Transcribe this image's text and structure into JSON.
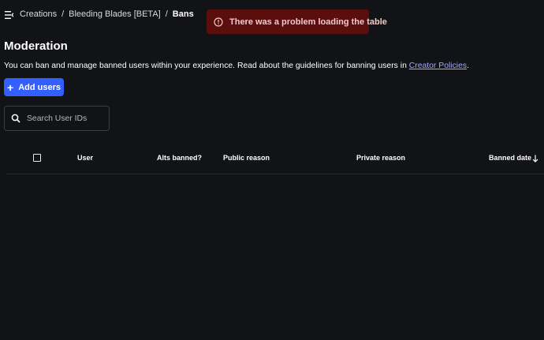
{
  "breadcrumb": {
    "items": [
      "Creations",
      "Bleeding Blades [BETA]",
      "Bans"
    ],
    "separator": "/"
  },
  "toast": {
    "message": "There was a problem loading the table",
    "icon": "alert-circle-icon",
    "color": "#5a0e0e"
  },
  "page": {
    "title": "Moderation",
    "description": "You can ban and manage banned users within your experience. Read about the guidelines for banning users in ",
    "link_text": "Creator Policies",
    "description_end": "."
  },
  "actions": {
    "add_label": "Add users",
    "accent": "#335fff"
  },
  "search": {
    "placeholder": "Search User IDs",
    "value": ""
  },
  "table": {
    "columns": [
      "User",
      "Alts banned?",
      "Public reason",
      "Private reason",
      "Banned date"
    ],
    "sort_column": "Banned date",
    "sort_direction": "descending",
    "rows": []
  }
}
